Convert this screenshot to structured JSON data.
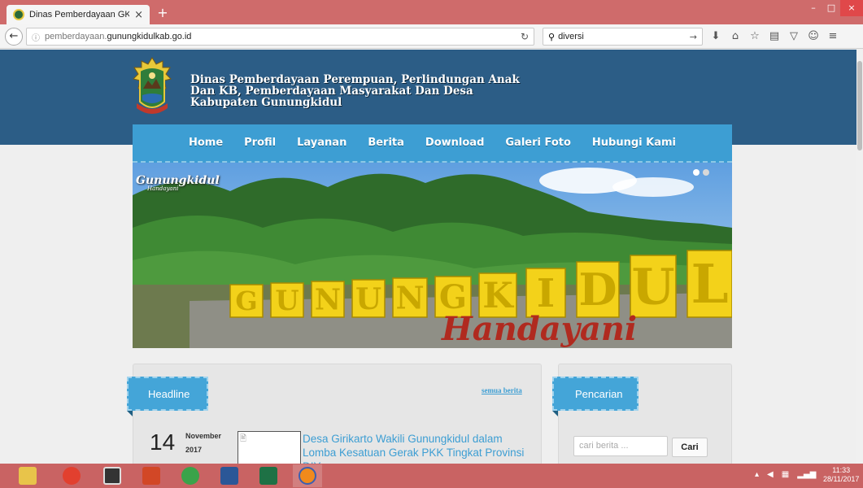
{
  "browser": {
    "tab_title": "Dinas Pemberdayaan GK",
    "tab_close": "×",
    "new_tab": "+",
    "url_prefix": "pemberdayaan.",
    "url_domain": "gunungkidulkab.go.id",
    "search_value": "diversi",
    "window_buttons": [
      "–",
      "□",
      "×"
    ]
  },
  "site": {
    "title_line1": "Dinas Pemberdayaan Perempuan, Perlindungan Anak",
    "title_line2": "Dan KB, Pemberdayaan Masyarakat Dan Desa",
    "title_line3": "Kabupaten Gunungkidul",
    "menu": [
      "Home",
      "Profil",
      "Layanan",
      "Berita",
      "Download",
      "Galeri Foto",
      "Hubungi Kami"
    ],
    "banner": {
      "brand": "Gunungkidul",
      "brand_sub": "Handayani",
      "sign_text": "GUNUNGKIDUL",
      "sign_script": "Handayani"
    }
  },
  "headline": {
    "label": "Headline",
    "all_news": "semua berita",
    "item": {
      "day": "14",
      "month": "November",
      "year": "2017",
      "title": "Desa Girikarto Wakili Gunungkidul dalam Lomba Kesatuan Gerak PKK Tingkat Provinsi DIY"
    }
  },
  "search": {
    "label": "Pencarian",
    "placeholder": "cari berita ...",
    "button": "Cari"
  },
  "taskbar": {
    "time": "11:33",
    "date": "28/11/2017"
  },
  "colors": {
    "header_bg": "#2c5d86",
    "menu_bg": "#3d9ed3",
    "chrome_bg": "#cf6b6b",
    "link": "#3d9ed3"
  }
}
